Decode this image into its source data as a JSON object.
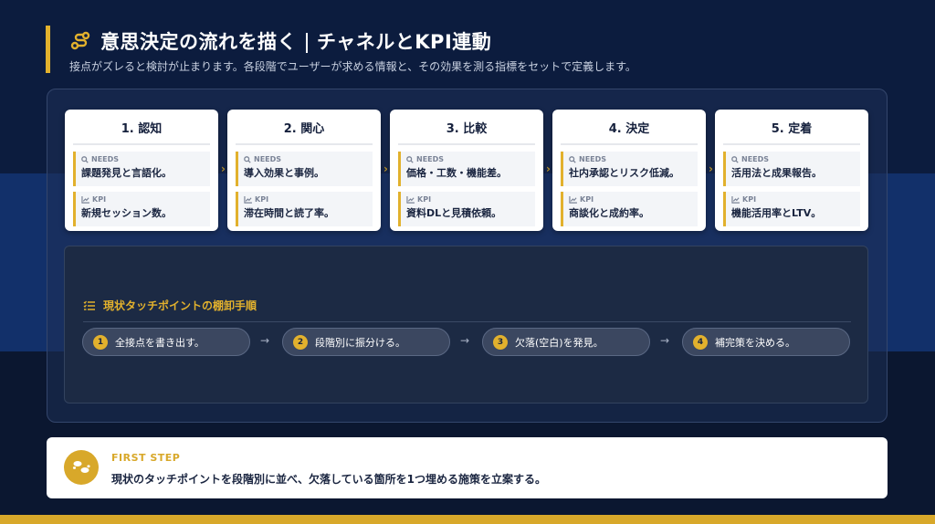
{
  "header": {
    "title_main": "意思決定の流れを描く",
    "title_sub": "チャネルとKPI連動",
    "subtitle": "接点がズレると検討が止まります。各段階でユーザーが求める情報と、その効果を測る指標をセットで定義します。"
  },
  "stages": [
    {
      "title": "1. 認知",
      "needs_label": "NEEDS",
      "needs": "課題発見と言語化。",
      "kpi_label": "KPI",
      "kpi": "新規セッション数。"
    },
    {
      "title": "2. 関心",
      "needs_label": "NEEDS",
      "needs": "導入効果と事例。",
      "kpi_label": "KPI",
      "kpi": "滞在時間と読了率。"
    },
    {
      "title": "3. 比較",
      "needs_label": "NEEDS",
      "needs": "価格・工数・機能差。",
      "kpi_label": "KPI",
      "kpi": "資料DLと見積依頼。"
    },
    {
      "title": "4. 決定",
      "needs_label": "NEEDS",
      "needs": "社内承認とリスク低減。",
      "kpi_label": "KPI",
      "kpi": "商談化と成約率。"
    },
    {
      "title": "5. 定着",
      "needs_label": "NEEDS",
      "needs": "活用法と成果報告。",
      "kpi_label": "KPI",
      "kpi": "機能活用率とLTV。"
    }
  ],
  "inventory": {
    "title": "現状タッチポイントの棚卸手順",
    "steps": [
      {
        "num": "1",
        "text": "全接点を書き出す。"
      },
      {
        "num": "2",
        "text": "段階別に振分ける。"
      },
      {
        "num": "3",
        "text": "欠落(空白)を発見。"
      },
      {
        "num": "4",
        "text": "補完策を決める。"
      }
    ]
  },
  "first_step": {
    "label": "FIRST STEP",
    "text": "現状のタッチポイントを段階別に並べ、欠落している箇所を1つ埋める施策を立案する。"
  },
  "colors": {
    "accent": "#e2b12d",
    "navy": "#0c1a38",
    "band": "#12306a"
  },
  "icons": {
    "title": "route-icon",
    "needs": "search-icon",
    "kpi": "chart-line-icon",
    "inventory": "checklist-icon",
    "first_step": "footprints-icon"
  }
}
